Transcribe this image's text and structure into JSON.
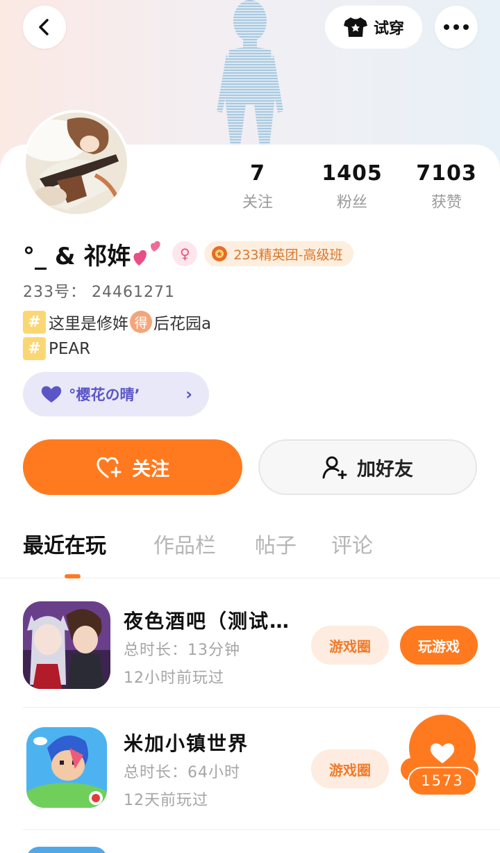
{
  "header": {
    "tryon_label": "试穿"
  },
  "stats": [
    {
      "value": "7",
      "label": "关注"
    },
    {
      "value": "1405",
      "label": "粉丝"
    },
    {
      "value": "7103",
      "label": "获赞"
    }
  ],
  "profile": {
    "name": "°_ & 祁姩",
    "gender_symbol": "♀",
    "badge": "233精英团-高级班",
    "uid_label": "233号：",
    "uid": "24461271",
    "tag1_before": "这里是修姩",
    "tag1_char": "得",
    "tag1_after": "后花园a",
    "tag2": "PEAR",
    "hash_symbol": "#",
    "club": "°樱花の晴’"
  },
  "actions": {
    "follow": "关注",
    "add_friend": "加好友"
  },
  "tabs": [
    "最近在玩",
    "作品栏",
    "帖子",
    "评论"
  ],
  "games": [
    {
      "title": "夜色酒吧（测试版）",
      "duration": "总时长：13分钟",
      "last_played": "12小时前玩过",
      "circle_label": "游戏圈",
      "play_label": "玩游戏"
    },
    {
      "title": "米加小镇世界",
      "duration": "总时长：64小时",
      "last_played": "12天前玩过",
      "circle_label": "游戏圈"
    }
  ],
  "like_count": "1573",
  "colors": {
    "accent": "#ff7a1f",
    "club_text": "#5b55c8",
    "badge_text": "#d9772c"
  }
}
